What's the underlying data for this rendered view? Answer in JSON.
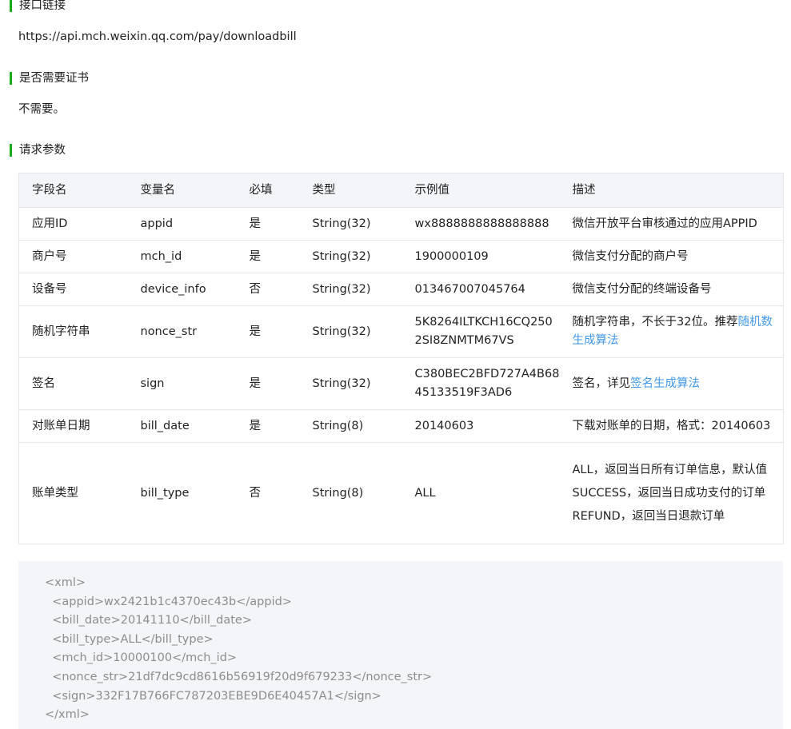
{
  "sections": {
    "url_title": "接口链接",
    "url_value": "https://api.mch.weixin.qq.com/pay/downloadbill",
    "cert_title": "是否需要证书",
    "cert_value": "不需要。",
    "params_title": "请求参数"
  },
  "table": {
    "headers": [
      "字段名",
      "变量名",
      "必填",
      "类型",
      "示例值",
      "描述"
    ],
    "rows": [
      {
        "field": "应用ID",
        "var": "appid",
        "required": "是",
        "type": "String(32)",
        "example": "wx8888888888888888",
        "desc_text": "微信开放平台审核通过的应用APPID"
      },
      {
        "field": "商户号",
        "var": "mch_id",
        "required": "是",
        "type": "String(32)",
        "example": "1900000109",
        "desc_text": "微信支付分配的商户号"
      },
      {
        "field": "设备号",
        "var": "device_info",
        "required": "否",
        "type": "String(32)",
        "example": "013467007045764",
        "desc_text": "微信支付分配的终端设备号"
      },
      {
        "field": "随机字符串",
        "var": "nonce_str",
        "required": "是",
        "type": "String(32)",
        "example": "5K8264ILTKCH16CQ2502SI8ZNMTM67VS",
        "desc_text": "随机字符串，不长于32位。推荐",
        "desc_link": "随机数生成算法"
      },
      {
        "field": "签名",
        "var": "sign",
        "required": "是",
        "type": "String(32)",
        "example": "C380BEC2BFD727A4B6845133519F3AD6",
        "desc_text": "签名，详见",
        "desc_link": "签名生成算法"
      },
      {
        "field": "对账单日期",
        "var": "bill_date",
        "required": "是",
        "type": "String(8)",
        "example": "20140603",
        "desc_text": "下载对账单的日期，格式：20140603"
      },
      {
        "field": "账单类型",
        "var": "bill_type",
        "required": "否",
        "type": "String(8)",
        "example": "ALL",
        "desc_lines": [
          "ALL，返回当日所有订单信息，默认值",
          "SUCCESS，返回当日成功支付的订单",
          "REFUND，返回当日退款订单"
        ]
      }
    ]
  },
  "code": {
    "lines": [
      "<xml>",
      "  <appid>wx2421b1c4370ec43b</appid>",
      "  <bill_date>20141110</bill_date>",
      "  <bill_type>ALL</bill_type>",
      "  <mch_id>10000100</mch_id>",
      "  <nonce_str>21df7dc9cd8616b56919f20d9f679233</nonce_str>",
      "  <sign>332F17B766FC787203EBE9D6E40457A1</sign>",
      "</xml>"
    ]
  },
  "colors": {
    "accent": "#1aad19",
    "link": "#459ae9",
    "header_bg": "#f4f5f9",
    "code_text": "#8d8d8d"
  }
}
